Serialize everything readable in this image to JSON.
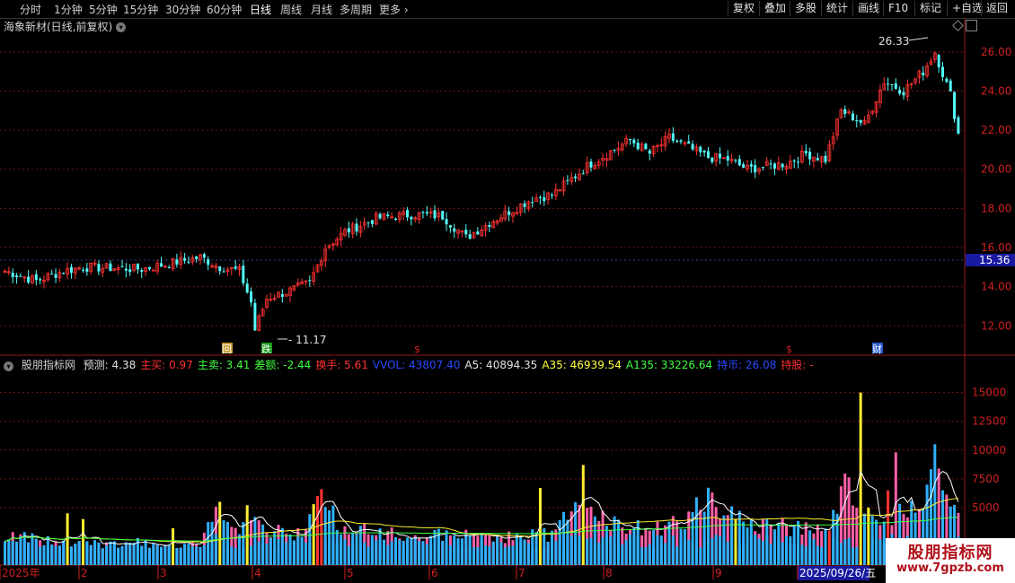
{
  "toolbar": {
    "timeframes": [
      "分时",
      "1分钟",
      "5分钟",
      "15分钟",
      "30分钟",
      "60分钟",
      "日线",
      "周线",
      "月线",
      "多周期",
      "更多"
    ],
    "active": "日线",
    "right_buttons": [
      "复权",
      "叠加",
      "多股",
      "统计",
      "画线",
      "F10",
      "标记",
      "+自选",
      "返回"
    ]
  },
  "title": "海象新材(日线,前复权)",
  "price_axis": {
    "ticks": [
      "26.00",
      "24.00",
      "22.00",
      "20.00",
      "18.00",
      "16.00",
      "14.00",
      "12.00"
    ],
    "current": "15.36",
    "high_label": "26.33",
    "low_label": "11.17"
  },
  "event_markers": [
    {
      "text": "回",
      "color": "#c89a2a"
    },
    {
      "text": "跌",
      "color": "#1a9a1a"
    },
    {
      "text": "$",
      "color": "#d02020"
    },
    {
      "text": "$",
      "color": "#d02020"
    },
    {
      "text": "财",
      "color": "#2a5ad0"
    }
  ],
  "indicator": {
    "name": "股朋指标网",
    "items": [
      {
        "label": "预测:",
        "value": "4.38",
        "color": "#e0e0e0"
      },
      {
        "label": "主买:",
        "value": "0.97",
        "color": "#ff3030"
      },
      {
        "label": "主卖:",
        "value": "3.41",
        "color": "#40ff40"
      },
      {
        "label": "差额:",
        "value": "-2.44",
        "color": "#40ff40"
      },
      {
        "label": "换手:",
        "value": "5.61",
        "color": "#ff3030"
      },
      {
        "label": "VVOL:",
        "value": "43807.40",
        "color": "#2a4aff"
      },
      {
        "label": "A5:",
        "value": "40894.35",
        "color": "#e0e0e0"
      },
      {
        "label": "A35:",
        "value": "46939.54",
        "color": "#ffff40"
      },
      {
        "label": "A135:",
        "value": "33226.64",
        "color": "#40ff40"
      },
      {
        "label": "持币:",
        "value": "26.08",
        "color": "#2a4aff"
      },
      {
        "label": "持股:",
        "value": "-",
        "color": "#ff3030"
      }
    ]
  },
  "volume_axis": {
    "ticks": [
      "15000",
      "12500",
      "10000",
      "7500",
      "5000"
    ]
  },
  "date_axis": {
    "labels": [
      "2025年",
      "2",
      "3",
      "4",
      "5",
      "6",
      "7",
      "8",
      "9",
      "2025/09/26/五"
    ]
  },
  "logo": {
    "line1": "股朋指标网",
    "line2": "www.7gpzb.com"
  },
  "colors": {
    "up": "#ff3232",
    "down": "#54fcfc",
    "pink": "#ff5fa8",
    "cyan": "#30b0ff",
    "yellow": "#ffee30",
    "grid": "#7a1010"
  },
  "chart_data": {
    "type": "candlestick",
    "price_ylim": [
      10.5,
      27
    ],
    "volume_ylim": [
      0,
      17000
    ],
    "price_keyframes": [
      [
        0,
        14.8
      ],
      [
        8,
        14.3
      ],
      [
        15,
        14.8
      ],
      [
        20,
        15.0
      ],
      [
        35,
        14.9
      ],
      [
        45,
        15.3
      ],
      [
        50,
        15.5
      ],
      [
        55,
        15.0
      ],
      [
        60,
        14.8
      ],
      [
        63,
        13.2
      ],
      [
        64,
        11.8
      ],
      [
        67,
        13.4
      ],
      [
        73,
        13.8
      ],
      [
        78,
        14.2
      ],
      [
        82,
        16.0
      ],
      [
        87,
        16.8
      ],
      [
        95,
        17.5
      ],
      [
        105,
        17.7
      ],
      [
        112,
        17.6
      ],
      [
        118,
        16.5
      ],
      [
        125,
        17.4
      ],
      [
        135,
        18.5
      ],
      [
        140,
        18.7
      ],
      [
        150,
        20.3
      ],
      [
        160,
        21.5
      ],
      [
        165,
        20.8
      ],
      [
        170,
        21.6
      ],
      [
        180,
        20.6
      ],
      [
        185,
        20.5
      ],
      [
        190,
        20.0
      ],
      [
        200,
        20.3
      ],
      [
        205,
        20.8
      ],
      [
        210,
        20.5
      ],
      [
        214,
        23.0
      ],
      [
        220,
        22.3
      ],
      [
        225,
        24.5
      ],
      [
        230,
        24.0
      ],
      [
        235,
        25.0
      ],
      [
        238,
        26.0
      ],
      [
        242,
        23.8
      ],
      [
        244,
        21.8
      ]
    ],
    "volume_keyframes": [
      [
        0,
        2500
      ],
      [
        20,
        1800
      ],
      [
        50,
        2000
      ],
      [
        52,
        4800
      ],
      [
        60,
        2300
      ],
      [
        63,
        5200
      ],
      [
        65,
        3200
      ],
      [
        75,
        2800
      ],
      [
        80,
        4200
      ],
      [
        82,
        6500
      ],
      [
        85,
        3200
      ],
      [
        100,
        2600
      ],
      [
        125,
        2500
      ],
      [
        140,
        2600
      ],
      [
        145,
        4500
      ],
      [
        150,
        5000
      ],
      [
        157,
        3500
      ],
      [
        165,
        3000
      ],
      [
        175,
        4200
      ],
      [
        180,
        5500
      ],
      [
        190,
        3800
      ],
      [
        200,
        3200
      ],
      [
        210,
        3000
      ],
      [
        215,
        6500
      ],
      [
        220,
        5500
      ],
      [
        225,
        4000
      ],
      [
        235,
        6000
      ],
      [
        238,
        9500
      ],
      [
        242,
        5000
      ],
      [
        244,
        4000
      ]
    ],
    "volume_spikes": [
      {
        "i": 16,
        "v": 4500,
        "c": "#ffee30"
      },
      {
        "i": 20,
        "v": 4000,
        "c": "#ffee30"
      },
      {
        "i": 43,
        "v": 3200,
        "c": "#ffee30"
      },
      {
        "i": 55,
        "v": 5500,
        "c": "#ffee30"
      },
      {
        "i": 62,
        "v": 5200,
        "c": "#ffee30"
      },
      {
        "i": 79,
        "v": 5300,
        "c": "#ffee30"
      },
      {
        "i": 80,
        "v": 6000,
        "c": "#ff3232"
      },
      {
        "i": 81,
        "v": 6600,
        "c": "#ff3232"
      },
      {
        "i": 137,
        "v": 6700,
        "c": "#ffee30"
      },
      {
        "i": 148,
        "v": 8700,
        "c": "#ffee30"
      },
      {
        "i": 187,
        "v": 4000,
        "c": "#ffee30"
      },
      {
        "i": 211,
        "v": 3000,
        "c": "#ff3232"
      },
      {
        "i": 219,
        "v": 15000,
        "c": "#ffee30"
      },
      {
        "i": 221,
        "v": 5000,
        "c": "#ffee30"
      },
      {
        "i": 226,
        "v": 6500,
        "c": "#ff3232"
      },
      {
        "i": 228,
        "v": 9800,
        "c": "#ff5fa8"
      }
    ]
  }
}
